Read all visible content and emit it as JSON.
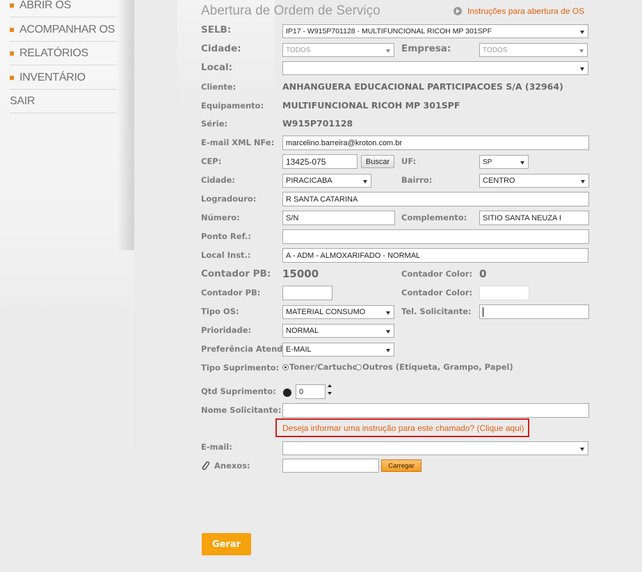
{
  "sidebar": {
    "items": [
      {
        "label": "ABRIR OS",
        "bullet": true
      },
      {
        "label": "ACOMPANHAR OS",
        "bullet": true
      },
      {
        "label": "RELATÓRIOS",
        "bullet": true
      },
      {
        "label": "INVENTÁRIO",
        "bullet": true
      },
      {
        "label": "SAIR",
        "bullet": false
      }
    ]
  },
  "page": {
    "title": "Abertura de Ordem de Serviço",
    "instructions_link": "Instruções para abertura de OS"
  },
  "form": {
    "selb": {
      "label": "SELB:",
      "value": "IP17 - W915P701128 - MULTIFUNCIONAL RICOH MP 301SPF"
    },
    "cidade_filter": {
      "label": "Cidade:",
      "value": "TODOS"
    },
    "empresa_filter": {
      "label": "Empresa:",
      "value": "TODOS"
    },
    "local": {
      "label": "Local:",
      "value": ""
    },
    "cliente": {
      "label": "Cliente:",
      "value": "ANHANGUERA EDUCACIONAL PARTICIPACOES S/A (32964)"
    },
    "equipamento": {
      "label": "Equipamento:",
      "value": "MULTIFUNCIONAL RICOH MP 301SPF"
    },
    "serie": {
      "label": "Série:",
      "value": "W915P701128"
    },
    "email_xml": {
      "label": "E-mail XML NFe:",
      "value": "marcelino.barreira@kroton.com.br"
    },
    "cep": {
      "label": "CEP:",
      "value": "13425-075",
      "button": "Buscar"
    },
    "uf": {
      "label": "UF:",
      "value": "SP"
    },
    "cidade": {
      "label": "Cidade:",
      "value": "PIRACICABA"
    },
    "bairro": {
      "label": "Bairro:",
      "value": "CENTRO"
    },
    "logradouro": {
      "label": "Logradouro:",
      "value": "R SANTA CATARINA"
    },
    "numero": {
      "label": "Número:",
      "value": "S/N"
    },
    "complemento": {
      "label": "Complemento:",
      "value": "SITIO SANTA NEUZA I"
    },
    "ponto_ref": {
      "label": "Ponto Ref.:",
      "value": ""
    },
    "local_inst": {
      "label": "Local Inst.:",
      "value": "A - ADM - ALMOXARIFADO - NORMAL"
    },
    "contador_pb_display": {
      "label": "Contador PB:",
      "value": "15000"
    },
    "contador_color_display": {
      "label": "Contador Color:",
      "value": "0"
    },
    "contador_pb_input": {
      "label": "Contador PB:",
      "value": ""
    },
    "contador_color_input": {
      "label": "Contador Color:",
      "value": ""
    },
    "tipo_os": {
      "label": "Tipo OS:",
      "value": "MATERIAL CONSUMO"
    },
    "tel_solicitante": {
      "label": "Tel. Solicitante:",
      "value": ""
    },
    "prioridade": {
      "label": "Prioridade:",
      "value": "NORMAL"
    },
    "preferencia": {
      "label": "Preferência Atend:",
      "value": "E-MAIL"
    },
    "tipo_suprimento": {
      "label": "Tipo Suprimento:",
      "option1": "Toner/Cartucho",
      "option2": "Outros (Etiqueta, Grampo, Papel)",
      "selected": "option1"
    },
    "qtd_suprimento": {
      "label": "Qtd Suprimento:",
      "value": "0"
    },
    "nome_solicitante": {
      "label": "Nome Solicitante:",
      "value": ""
    },
    "instruction_link": "Deseja informar uma instrução para este chamado? (Clique aqui)",
    "email": {
      "label": "E-mail:",
      "value": ""
    },
    "anexos": {
      "label": "Anexos:",
      "value": "",
      "button": "Carregar"
    },
    "submit": "Gerar"
  },
  "colors": {
    "accent": "#f5a20c",
    "link": "#e55d10",
    "highlight_border": "#d61b1b"
  }
}
